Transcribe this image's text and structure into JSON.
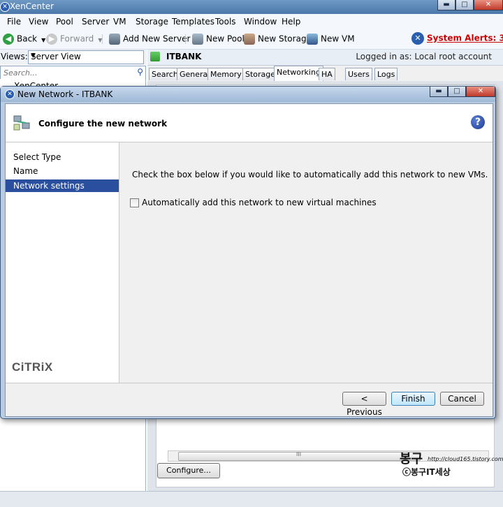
{
  "app": {
    "title": "XenCenter",
    "menu": [
      "File",
      "View",
      "Pool",
      "Server",
      "VM",
      "Storage",
      "Templates",
      "Tools",
      "Window",
      "Help"
    ],
    "toolbar": {
      "back": "Back",
      "forward": "Forward",
      "add_new_server": "Add New Server",
      "new_pool": "New Pool",
      "new_storage": "New Storage",
      "new_vm": "New VM",
      "system_alerts": "System Alerts: 3"
    },
    "views_label": "Views:",
    "views_value": "Server View",
    "search_placeholder": "Search...",
    "tree_root": "XenCenter",
    "server_name": "ITBANK",
    "logged_in": "Logged in as: Local root account",
    "tabs": [
      "Search",
      "General",
      "Memory",
      "Storage",
      "Networking",
      "HA",
      "Users",
      "Logs"
    ],
    "active_tab": "Networking",
    "configure_button": "Configure...",
    "hscroll_grip": "III",
    "watermark": {
      "big": "봉구",
      "url": "http://cloud165.tistory.com/",
      "sub": "ⓒ봉구IT세상"
    }
  },
  "dialog": {
    "title": "New Network - ITBANK",
    "header_title": "Configure the new network",
    "nav_items": [
      "Select Type",
      "Name",
      "Network settings"
    ],
    "active_nav": "Network settings",
    "description": "Check the box below if you would like to automatically add this network to new VMs.",
    "checkbox_label": "Automatically add this network to new virtual machines",
    "checkbox_checked": false,
    "logo": "CiTRiX",
    "buttons": {
      "previous": "< Previous",
      "finish": "Finish",
      "cancel": "Cancel"
    }
  },
  "colors": {
    "accent": "#2a4f9e",
    "alert": "#cc0000",
    "titlebar": "#4a78aa"
  }
}
